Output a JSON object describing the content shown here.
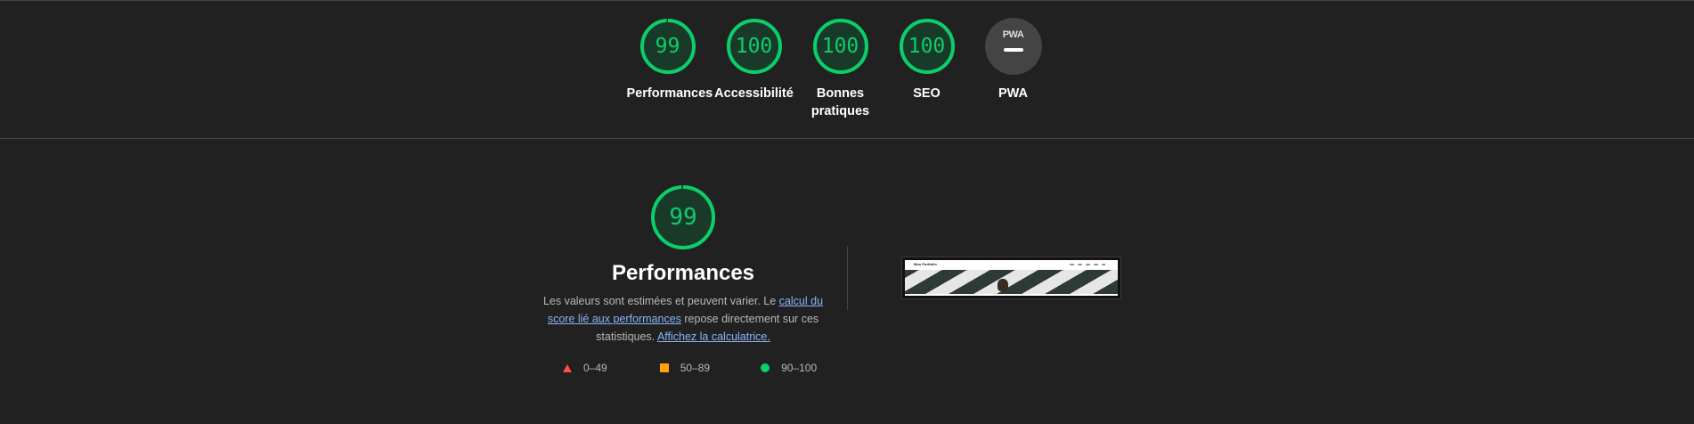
{
  "summary": {
    "categories": [
      {
        "label": "Performances",
        "score": "99",
        "fraction": 0.99
      },
      {
        "label": "Accessibilité",
        "score": "100",
        "fraction": 1.0
      },
      {
        "label": "Bonnes pratiques",
        "score": "100",
        "fraction": 1.0
      },
      {
        "label": "SEO",
        "score": "100",
        "fraction": 1.0
      },
      {
        "label": "PWA",
        "badge_text": "PWA"
      }
    ]
  },
  "performance": {
    "score": "99",
    "fraction": 0.99,
    "title": "Performances",
    "description_part1": "Les valeurs sont estimées et peuvent varier. Le ",
    "link1": "calcul du score lié aux performances",
    "description_part2": " repose directement sur ces statistiques. ",
    "link2": "Affichez la calculatrice."
  },
  "legend": [
    {
      "shape": "triangle",
      "label": "0–49",
      "color": "#ff4e42"
    },
    {
      "shape": "square",
      "label": "50–89",
      "color": "#ffa400"
    },
    {
      "shape": "circle",
      "label": "90–100",
      "color": "#0cce6b"
    }
  ],
  "thumbnail": {
    "site_name": "Mon Portfolio"
  },
  "colors": {
    "pass": "#0cce6b",
    "pass_track": "#1a3a29",
    "average": "#ffa400",
    "fail": "#ff4e42",
    "background": "#212121",
    "link": "#8ab4f8"
  }
}
